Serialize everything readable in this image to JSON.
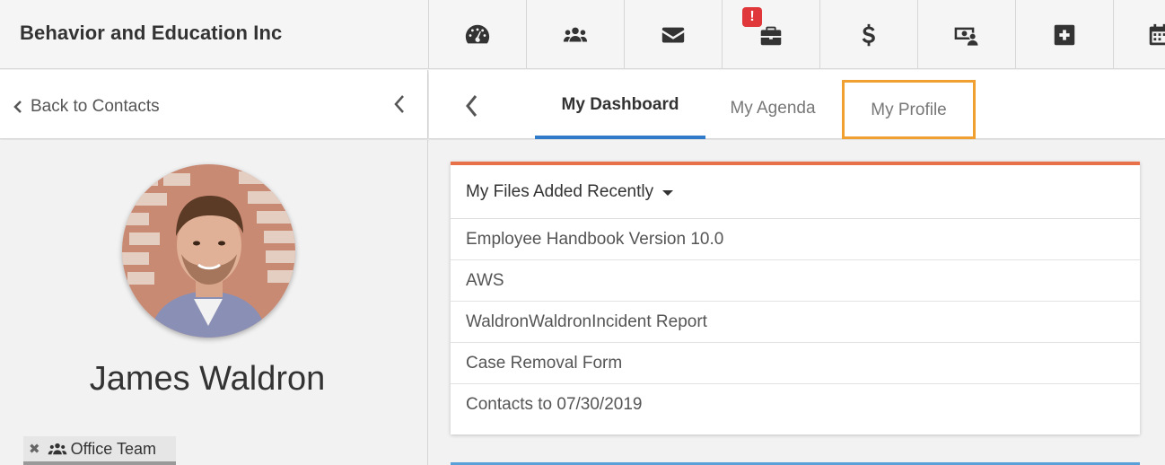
{
  "app": {
    "company_name": "Behavior and Education Inc"
  },
  "top_nav": {
    "icons": [
      "dashboard-gauge-icon",
      "people-group-icon",
      "envelope-icon",
      "briefcase-icon",
      "dollar-icon",
      "money-user-icon",
      "plus-square-icon",
      "calendar-icon"
    ],
    "alert_badge": "!"
  },
  "left_header": {
    "back_label": "Back to Contacts"
  },
  "profile": {
    "name": "James Waldron",
    "team_chip": {
      "remove": "✖",
      "label": "Office Team"
    }
  },
  "tabs": [
    {
      "label": "My Dashboard",
      "active": true
    },
    {
      "label": "My Agenda",
      "active": false
    },
    {
      "label": "My Profile",
      "active": false
    }
  ],
  "files_widget": {
    "title": "My Files Added Recently",
    "files": [
      "Employee Handbook Version 10.0",
      "AWS",
      "WaldronWaldronIncident Report",
      "Case Removal Form",
      "Contacts to 07/30/2019"
    ]
  },
  "colors": {
    "accent_blue": "#2f7bc9",
    "card_top_orange": "#e8714a",
    "highlight_orange": "#f0a030",
    "alert_red": "#e0373a"
  }
}
